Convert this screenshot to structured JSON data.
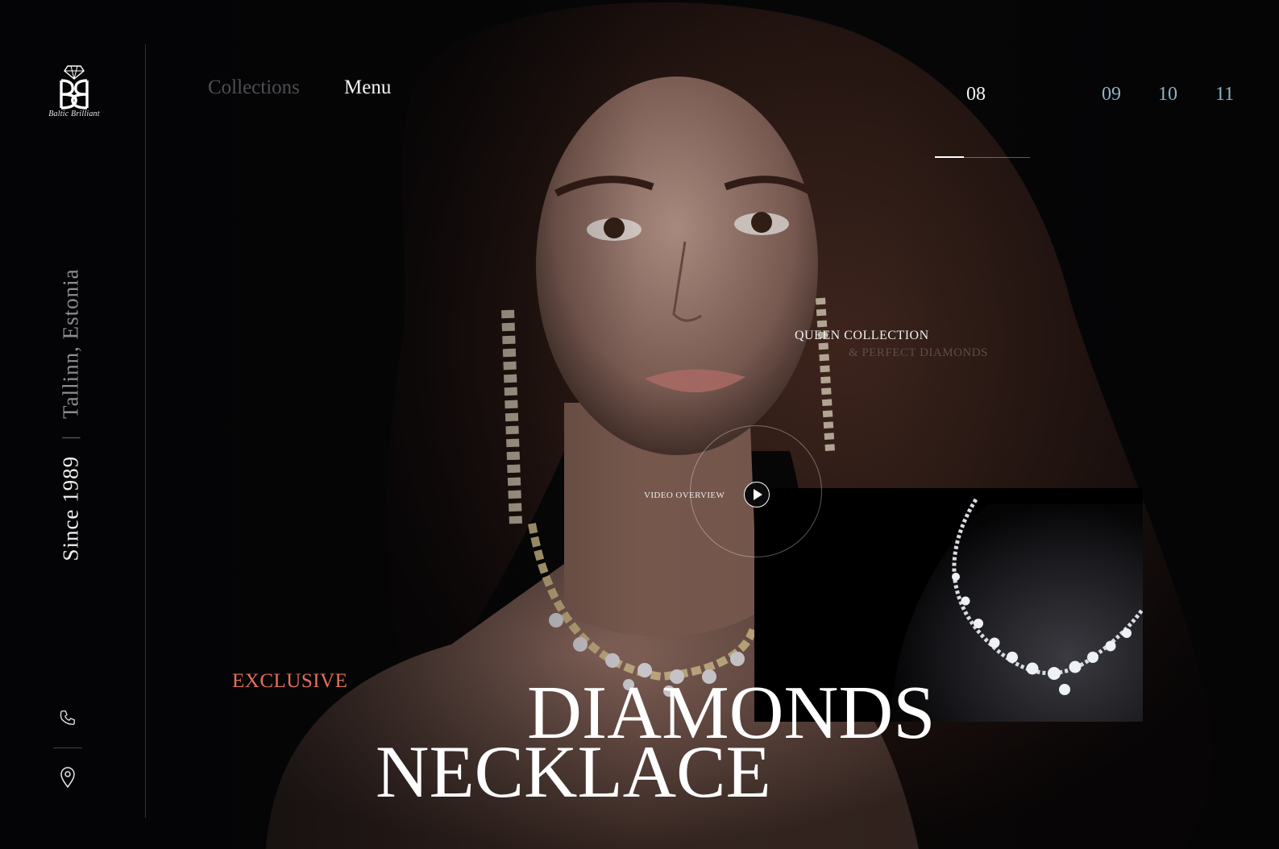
{
  "brand": {
    "name": "Baltic Brilliant",
    "monogram_icon": "bb-monogram-diamond-icon"
  },
  "rail": {
    "since": "Since 1989",
    "separator": "|",
    "location": "Tallinn, Estonia",
    "contact_icons": [
      "phone-icon",
      "location-pin-icon"
    ]
  },
  "nav": {
    "collections": "Collections",
    "menu": "Menu"
  },
  "slides": {
    "current": "08",
    "others": [
      "09",
      "10",
      "11"
    ],
    "current_color": "#f4f4f4",
    "inactive_color": "#8fb3c7"
  },
  "collection": {
    "title": "QUEEN COLLECTION",
    "subtitle": "& PERFECT DIAMONDS"
  },
  "video": {
    "label": "VIDEO OVERVIEW",
    "icon": "play-icon"
  },
  "headline": {
    "eyebrow": "EXCLUSIVE",
    "eyebrow_color": "#e4715a",
    "line1": "DIAMONDS",
    "line2": "NECKLACE"
  },
  "product": {
    "image": "diamond-necklace-on-bust"
  }
}
